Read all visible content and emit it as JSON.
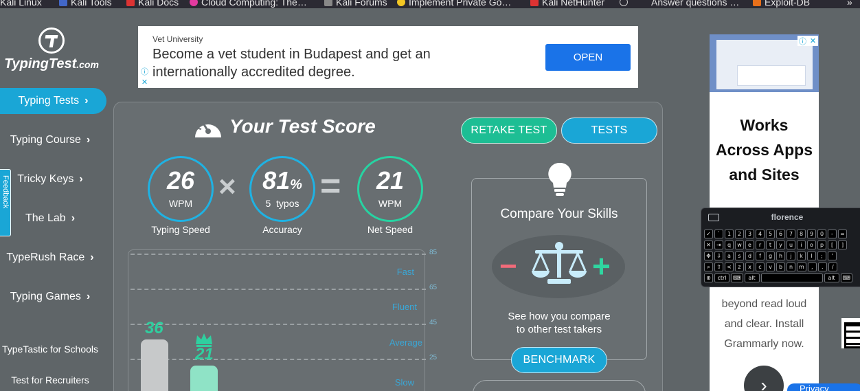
{
  "bookmarks": [
    {
      "label": "Kali Linux",
      "icon": "kali-icon",
      "color": "#367bf0"
    },
    {
      "label": "Kali Tools",
      "icon": "kali-tools-icon",
      "color": "#e33"
    },
    {
      "label": "Kali Docs",
      "icon": "kali-docs-icon",
      "color": "#e33"
    },
    {
      "label": "Cloud Computing: The…",
      "icon": "cloud-icon",
      "color": "#e33aa0"
    },
    {
      "label": "Kali Forums",
      "icon": "kali-forums-icon",
      "color": "#999"
    },
    {
      "label": "Implement Private Go…",
      "icon": "go-icon",
      "color": "#f3c623"
    },
    {
      "label": "Kali NetHunter",
      "icon": "nethunter-icon",
      "color": "#e33"
    },
    {
      "label": "",
      "icon": "globe-icon",
      "color": "#ccc"
    },
    {
      "label": "Answer questions …",
      "icon": "",
      "color": ""
    },
    {
      "label": "Exploit-DB",
      "icon": "exploit-db-icon",
      "color": "#e8701a"
    }
  ],
  "bookmarks_overflow": "»",
  "site": {
    "name": "TypingTest",
    "tld": ".com"
  },
  "nav": [
    {
      "label": "Typing Tests",
      "active": true
    },
    {
      "label": "Typing Course"
    },
    {
      "label": "Tricky Keys"
    },
    {
      "label": "The Lab"
    },
    {
      "label": "TypeRush Race"
    },
    {
      "label": "Typing Games"
    }
  ],
  "nav_small": [
    "TypeTastic for Schools",
    "Test for Recruiters"
  ],
  "feedback_tab": "Feedback",
  "top_ad": {
    "source": "Vet University",
    "headline": "Become a vet student in Budapest and get an internationally accredited degree.",
    "cta": "OPEN"
  },
  "score": {
    "title": "Your Test Score",
    "retake_label": "RETAKE TEST",
    "tests_label": "TESTS",
    "typing_speed": {
      "value": "26",
      "unit": "WPM",
      "label": "Typing Speed"
    },
    "accuracy": {
      "value": "81",
      "percent": "%",
      "typos": "5",
      "typos_label": "typos",
      "label": "Accuracy"
    },
    "net_speed": {
      "value": "21",
      "unit": "WPM",
      "label": "Net Speed"
    },
    "times_symbol": "×",
    "equals_symbol": "="
  },
  "chart": {
    "ticks": [
      "85",
      "65",
      "45",
      "25"
    ],
    "bands": [
      "Fast",
      "Fluent",
      "Average",
      "Slow"
    ],
    "bars": [
      {
        "label": "36",
        "value": 36,
        "color": "#c7c9ca",
        "label_color": "#2fcf9f"
      },
      {
        "label": "21",
        "value": 21,
        "color": "#8fe3c6",
        "label_color": "#2fcf9f"
      }
    ]
  },
  "compare": {
    "title": "Compare Your Skills",
    "minus": "−",
    "plus": "+",
    "desc_line1": "See how you compare",
    "desc_line2": "to other test takers",
    "benchmark_label": "BENCHMARK"
  },
  "right_ad": {
    "headline_1": "Works",
    "headline_2": "Across Apps",
    "headline_3": "and Sites",
    "body_1": "beyond read loud",
    "body_2": "and clear. Install",
    "body_3": "Grammarly now.",
    "next": "›"
  },
  "keyboard": {
    "title": "florence",
    "rows": [
      [
        "✓",
        "`",
        "1",
        "2",
        "3",
        "4",
        "5",
        "6",
        "7",
        "8",
        "9",
        "0",
        "-",
        "="
      ],
      [
        "✕",
        "⇥",
        "q",
        "w",
        "e",
        "r",
        "t",
        "y",
        "u",
        "i",
        "o",
        "p",
        "[",
        "]"
      ],
      [
        "✥",
        "⇩",
        "a",
        "s",
        "d",
        "f",
        "g",
        "h",
        "j",
        "k",
        "l",
        ";",
        "'"
      ],
      [
        "⌕",
        "⇧",
        "<",
        "z",
        "x",
        "c",
        "v",
        "b",
        "n",
        "m",
        ",",
        ".",
        "/"
      ],
      [
        "⊕",
        "ctrl",
        "⌨",
        "alt",
        "",
        "alt",
        "⌨"
      ]
    ]
  },
  "help_chip": "Privacy"
}
